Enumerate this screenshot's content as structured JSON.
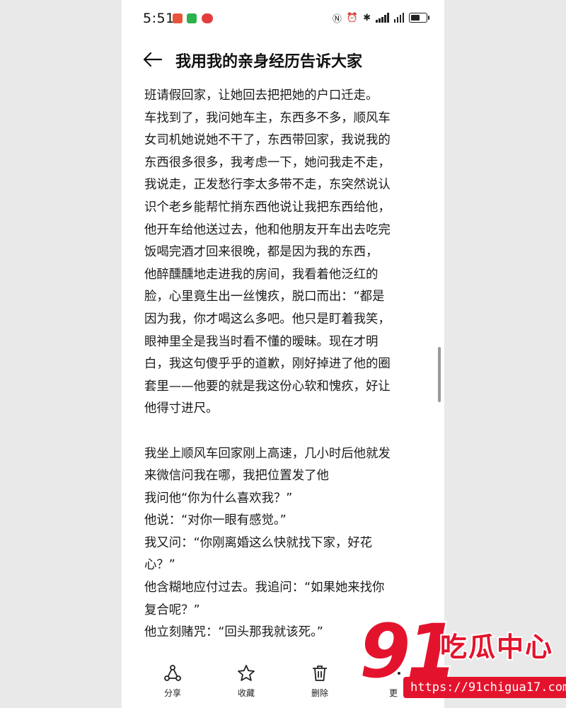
{
  "status_bar": {
    "time": "5:51",
    "notification_icons": [
      "news-app-icon",
      "wechat-icon",
      "app-badge-icon"
    ],
    "system_icons": [
      "nfc-icon",
      "alarm-icon",
      "bluetooth-icon",
      "signal-icon",
      "signal-icon",
      "battery-icon"
    ]
  },
  "header": {
    "back_icon": "arrow-left-icon",
    "title": "我用我的亲身经历告诉大家"
  },
  "content": {
    "lines": [
      "班请假回家，让她回去把把她的户口迁走。",
      "车找到了，我问她车主，东西多不多，顺风车",
      "女司机她说她不干了，东西带回家，我说我的",
      "东西很多很多，我考虑一下，她问我走不走，",
      "我说走，正发愁行李太多带不走，东突然说认",
      "识个老乡能帮忙捎东西他说让我把东西给他，",
      "他开车给他送过去，他和他朋友开车出去吃完",
      "饭喝完酒才回来很晚，都是因为我的东西，",
      "他醉醺醺地走进我的房间，我看着他泛红的",
      "脸，心里竟生出一丝愧疚，脱口而出：“都是",
      "因为我，你才喝这么多吧。他只是盯着我笑，",
      "眼神里全是我当时看不懂的暧昧。现在才明",
      "白，我这句傻乎乎的道歉，刚好掉进了他的圈",
      "套里——他要的就是我这份心软和愧疚，好让",
      "他得寸进尺。",
      "",
      "我坐上顺风车回家刚上高速，几小时后他就发",
      "来微信问我在哪，我把位置发了他",
      "我问他“你为什么喜欢我？”",
      "他说：“对你一眼有感觉。”",
      "我又问：“你刚离婚这么快就找下家，好花",
      "心？”",
      "他含糊地应付过去。我追问：“如果她来找你",
      "复合呢？”",
      "他立刻赌咒：“回头那我就该死。”"
    ]
  },
  "bottom_bar": {
    "share_label": "分享",
    "favorite_label": "收藏",
    "delete_label": "删除",
    "more_label": "更"
  },
  "watermark": {
    "number": "91",
    "name": "吃瓜中心",
    "url": "https://91chigua17.com"
  },
  "colors": {
    "watermark_red": "#e4132d",
    "text": "#1a1a1a",
    "background": "#ffffff"
  }
}
